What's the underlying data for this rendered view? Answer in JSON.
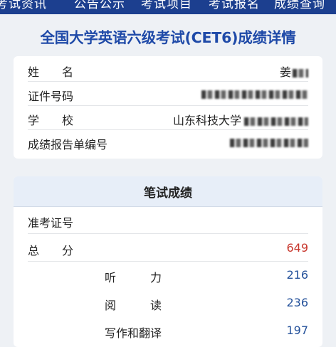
{
  "nav": {
    "items": [
      "考试资讯",
      "公告公示",
      "考试项目",
      "考试报名",
      "成绩查询"
    ]
  },
  "page_title": "全国大学英语六级考试(CET6)成绩详情",
  "info": {
    "rows": [
      {
        "label": "姓　　名",
        "value": "姜"
      },
      {
        "label": "证件号码",
        "value": ""
      },
      {
        "label": "学　　校",
        "value": "山东科技大学"
      },
      {
        "label": "成绩报告单编号",
        "value": ""
      }
    ]
  },
  "written": {
    "header": "笔试成绩",
    "ticket_label": "准考证号",
    "total_label": "总　　分",
    "total_value": "649",
    "subs": [
      {
        "label": "听　　　力",
        "value": "216"
      },
      {
        "label": "阅　　　读",
        "value": "236"
      },
      {
        "label": "写作和翻译",
        "value": "197"
      }
    ]
  },
  "colors": {
    "nav_bg": "#1c3f8f",
    "title": "#1f4aa8",
    "total_score": "#c8372d",
    "sub_score": "#25529b"
  }
}
